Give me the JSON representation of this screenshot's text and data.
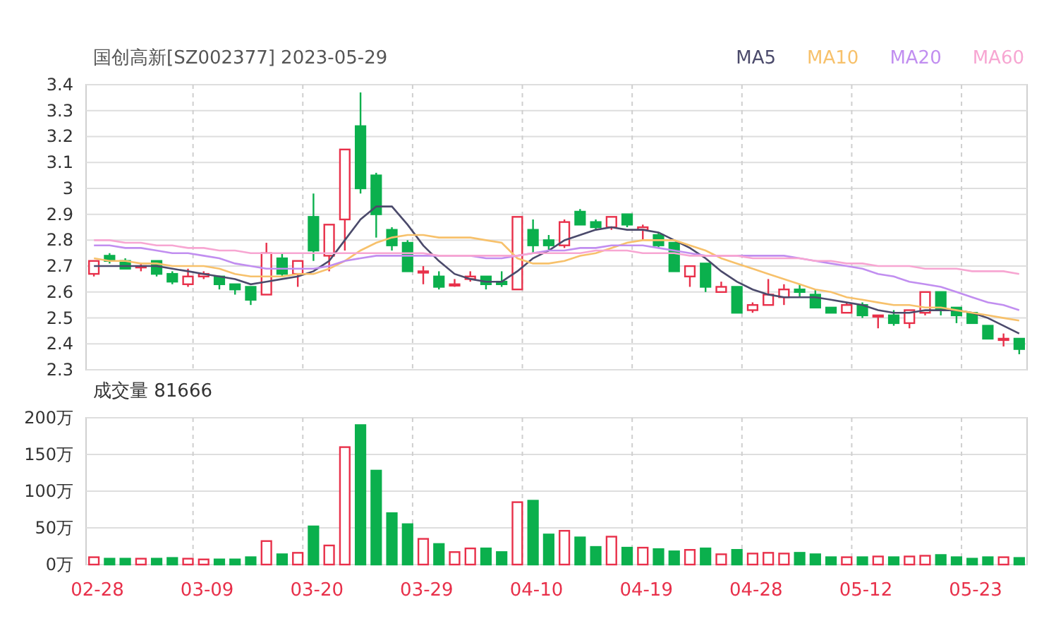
{
  "header": {
    "title": "国创高新[SZ002377] 2023-05-29"
  },
  "price_chart": {
    "chart_data": {
      "type": "candlestick",
      "grid": true,
      "categories": [
        null,
        null,
        null,
        null,
        null,
        null,
        null,
        null,
        null,
        null,
        null,
        null,
        null,
        null,
        null,
        null,
        null,
        null,
        null,
        null,
        null,
        null,
        null,
        null,
        null,
        null,
        null,
        null,
        null,
        null,
        null,
        null,
        null,
        null,
        null,
        null,
        null,
        null,
        null,
        null,
        null,
        null,
        null,
        null,
        null,
        null,
        null,
        null,
        null,
        null,
        null,
        null,
        null,
        null,
        null,
        null,
        null,
        null,
        null,
        null
      ],
      "ylim": [
        2.3,
        3.4
      ],
      "yticks": [
        {
          "value": 3.4,
          "label": "3.4"
        },
        {
          "value": 3.3,
          "label": "3.3"
        },
        {
          "value": 3.2,
          "label": "3.2"
        },
        {
          "value": 3.1,
          "label": "3.1"
        },
        {
          "value": 3.0,
          "label": "3"
        },
        {
          "value": 2.9,
          "label": "2.9"
        },
        {
          "value": 2.8,
          "label": "2.8"
        },
        {
          "value": 2.7,
          "label": "2.7"
        },
        {
          "value": 2.6,
          "label": "2.6"
        },
        {
          "value": 2.5,
          "label": "2.5"
        },
        {
          "value": 2.4,
          "label": "2.4"
        },
        {
          "value": 2.3,
          "label": "2.3"
        }
      ],
      "ohlc": [
        [
          2.67,
          2.72,
          2.66,
          2.72
        ],
        [
          2.74,
          2.75,
          2.71,
          2.72
        ],
        [
          2.72,
          2.73,
          2.69,
          2.69
        ],
        [
          2.7,
          2.71,
          2.68,
          2.7
        ],
        [
          2.72,
          2.72,
          2.66,
          2.67
        ],
        [
          2.67,
          2.68,
          2.63,
          2.64
        ],
        [
          2.63,
          2.69,
          2.62,
          2.66
        ],
        [
          2.66,
          2.68,
          2.65,
          2.67
        ],
        [
          2.66,
          2.66,
          2.61,
          2.63
        ],
        [
          2.63,
          2.63,
          2.59,
          2.61
        ],
        [
          2.62,
          2.62,
          2.55,
          2.57
        ],
        [
          2.59,
          2.79,
          2.59,
          2.75
        ],
        [
          2.73,
          2.75,
          2.66,
          2.67
        ],
        [
          2.67,
          2.72,
          2.62,
          2.72
        ],
        [
          2.89,
          2.98,
          2.72,
          2.76
        ],
        [
          2.74,
          2.86,
          2.68,
          2.86
        ],
        [
          2.88,
          3.15,
          2.76,
          3.15
        ],
        [
          3.24,
          3.37,
          2.98,
          3.0
        ],
        [
          3.05,
          3.06,
          2.81,
          2.9
        ],
        [
          2.84,
          2.85,
          2.76,
          2.78
        ],
        [
          2.79,
          2.8,
          2.68,
          2.68
        ],
        [
          2.68,
          2.7,
          2.63,
          2.68
        ],
        [
          2.66,
          2.68,
          2.61,
          2.62
        ],
        [
          2.63,
          2.65,
          2.62,
          2.63
        ],
        [
          2.65,
          2.68,
          2.64,
          2.66
        ],
        [
          2.66,
          2.66,
          2.61,
          2.63
        ],
        [
          2.64,
          2.68,
          2.62,
          2.63
        ],
        [
          2.61,
          2.89,
          2.61,
          2.89
        ],
        [
          2.84,
          2.88,
          2.75,
          2.78
        ],
        [
          2.8,
          2.82,
          2.76,
          2.78
        ],
        [
          2.78,
          2.88,
          2.77,
          2.87
        ],
        [
          2.91,
          2.92,
          2.86,
          2.86
        ],
        [
          2.87,
          2.88,
          2.84,
          2.85
        ],
        [
          2.85,
          2.89,
          2.84,
          2.89
        ],
        [
          2.9,
          2.9,
          2.85,
          2.86
        ],
        [
          2.84,
          2.86,
          2.8,
          2.85
        ],
        [
          2.82,
          2.83,
          2.77,
          2.78
        ],
        [
          2.79,
          2.79,
          2.68,
          2.68
        ],
        [
          2.66,
          2.7,
          2.62,
          2.7
        ],
        [
          2.71,
          2.71,
          2.6,
          2.62
        ],
        [
          2.6,
          2.64,
          2.6,
          2.62
        ],
        [
          2.62,
          2.62,
          2.52,
          2.52
        ],
        [
          2.53,
          2.56,
          2.52,
          2.55
        ],
        [
          2.55,
          2.65,
          2.55,
          2.59
        ],
        [
          2.58,
          2.63,
          2.55,
          2.61
        ],
        [
          2.61,
          2.63,
          2.58,
          2.6
        ],
        [
          2.59,
          2.61,
          2.54,
          2.54
        ],
        [
          2.54,
          2.54,
          2.52,
          2.52
        ],
        [
          2.52,
          2.56,
          2.52,
          2.55
        ],
        [
          2.55,
          2.56,
          2.5,
          2.51
        ],
        [
          2.51,
          2.51,
          2.46,
          2.51
        ],
        [
          2.51,
          2.53,
          2.47,
          2.48
        ],
        [
          2.48,
          2.53,
          2.46,
          2.53
        ],
        [
          2.52,
          2.6,
          2.51,
          2.6
        ],
        [
          2.6,
          2.6,
          2.51,
          2.53
        ],
        [
          2.54,
          2.54,
          2.48,
          2.51
        ],
        [
          2.52,
          2.52,
          2.48,
          2.48
        ],
        [
          2.47,
          2.47,
          2.42,
          2.42
        ],
        [
          2.42,
          2.44,
          2.39,
          2.42
        ],
        [
          2.42,
          2.42,
          2.36,
          2.38
        ]
      ]
    }
  },
  "ma_chart": {
    "chart_data": {
      "type": "line",
      "categories": [
        null,
        null,
        null,
        null,
        null,
        null,
        null,
        null,
        null,
        null,
        null,
        null,
        null,
        null,
        null,
        null,
        null,
        null,
        null,
        null,
        null,
        null,
        null,
        null,
        null,
        null,
        null,
        null,
        null,
        null,
        null,
        null,
        null,
        null,
        null,
        null,
        null,
        null,
        null,
        null,
        null,
        null,
        null,
        null,
        null,
        null,
        null,
        null,
        null,
        null,
        null,
        null,
        null,
        null,
        null,
        null,
        null,
        null,
        null,
        null
      ],
      "ylim": [
        2.3,
        3.4
      ],
      "series": [
        {
          "name": "MA5",
          "color": "#4b4a6b",
          "values": [
            2.7,
            2.7,
            2.7,
            2.7,
            2.7,
            2.69,
            2.68,
            2.67,
            2.66,
            2.65,
            2.63,
            2.64,
            2.65,
            2.66,
            2.68,
            2.72,
            2.8,
            2.88,
            2.93,
            2.93,
            2.86,
            2.78,
            2.72,
            2.67,
            2.65,
            2.64,
            2.64,
            2.68,
            2.73,
            2.76,
            2.8,
            2.82,
            2.84,
            2.85,
            2.84,
            2.84,
            2.83,
            2.8,
            2.77,
            2.73,
            2.68,
            2.64,
            2.61,
            2.59,
            2.58,
            2.58,
            2.58,
            2.57,
            2.56,
            2.55,
            2.53,
            2.52,
            2.52,
            2.53,
            2.53,
            2.53,
            2.52,
            2.5,
            2.47,
            2.44
          ]
        },
        {
          "name": "MA10",
          "color": "#f7c16b",
          "values": [
            2.73,
            2.72,
            2.72,
            2.71,
            2.71,
            2.7,
            2.7,
            2.7,
            2.69,
            2.67,
            2.66,
            2.66,
            2.66,
            2.67,
            2.67,
            2.69,
            2.72,
            2.76,
            2.79,
            2.81,
            2.82,
            2.82,
            2.81,
            2.81,
            2.81,
            2.8,
            2.79,
            2.73,
            2.71,
            2.71,
            2.72,
            2.74,
            2.75,
            2.77,
            2.79,
            2.8,
            2.8,
            2.8,
            2.78,
            2.76,
            2.73,
            2.71,
            2.69,
            2.67,
            2.65,
            2.63,
            2.61,
            2.6,
            2.58,
            2.57,
            2.56,
            2.55,
            2.55,
            2.54,
            2.54,
            2.53,
            2.52,
            2.51,
            2.5,
            2.49
          ]
        },
        {
          "name": "MA20",
          "color": "#c18ef0",
          "values": [
            2.78,
            2.78,
            2.77,
            2.77,
            2.76,
            2.75,
            2.75,
            2.74,
            2.73,
            2.71,
            2.7,
            2.69,
            2.69,
            2.69,
            2.69,
            2.7,
            2.72,
            2.73,
            2.74,
            2.74,
            2.74,
            2.74,
            2.74,
            2.74,
            2.74,
            2.73,
            2.73,
            2.74,
            2.75,
            2.76,
            2.76,
            2.77,
            2.77,
            2.78,
            2.78,
            2.78,
            2.77,
            2.76,
            2.75,
            2.74,
            2.74,
            2.74,
            2.74,
            2.74,
            2.74,
            2.73,
            2.72,
            2.71,
            2.7,
            2.69,
            2.67,
            2.66,
            2.64,
            2.63,
            2.62,
            2.6,
            2.58,
            2.56,
            2.55,
            2.53
          ]
        },
        {
          "name": "MA60",
          "color": "#f7a6d2",
          "values": [
            2.8,
            2.8,
            2.79,
            2.79,
            2.78,
            2.78,
            2.77,
            2.77,
            2.76,
            2.76,
            2.75,
            2.75,
            2.75,
            2.75,
            2.75,
            2.75,
            2.75,
            2.75,
            2.75,
            2.75,
            2.75,
            2.75,
            2.74,
            2.74,
            2.74,
            2.74,
            2.74,
            2.74,
            2.75,
            2.75,
            2.75,
            2.75,
            2.76,
            2.76,
            2.76,
            2.75,
            2.75,
            2.75,
            2.74,
            2.74,
            2.74,
            2.74,
            2.73,
            2.73,
            2.73,
            2.73,
            2.72,
            2.72,
            2.71,
            2.71,
            2.7,
            2.7,
            2.7,
            2.69,
            2.69,
            2.69,
            2.68,
            2.68,
            2.68,
            2.67
          ]
        }
      ]
    }
  },
  "volume_chart": {
    "title": "成交量 81666",
    "chart_data": {
      "type": "bar",
      "grid": true,
      "ylim": [
        0,
        200
      ],
      "categories": [
        "02-28",
        null,
        null,
        null,
        null,
        null,
        null,
        "03-09",
        null,
        null,
        null,
        null,
        null,
        null,
        "03-20",
        null,
        null,
        null,
        null,
        null,
        null,
        "03-29",
        null,
        null,
        null,
        null,
        null,
        null,
        "04-10",
        null,
        null,
        null,
        null,
        null,
        null,
        "04-19",
        null,
        null,
        null,
        null,
        null,
        null,
        "04-28",
        null,
        null,
        null,
        null,
        null,
        null,
        "05-12",
        null,
        null,
        null,
        null,
        null,
        null,
        "05-23",
        null,
        null,
        null
      ],
      "yticks": [
        {
          "value": 200,
          "label": "200万"
        },
        {
          "value": 150,
          "label": "150万"
        },
        {
          "value": 100,
          "label": "100万"
        },
        {
          "value": 50,
          "label": "50万"
        },
        {
          "value": 0,
          "label": "0万"
        }
      ],
      "values": [
        10,
        8,
        8,
        8,
        8,
        9,
        8,
        7,
        7,
        7,
        10,
        32,
        14,
        16,
        52,
        26,
        160,
        190,
        128,
        70,
        55,
        35,
        28,
        17,
        22,
        22,
        17,
        85,
        87,
        41,
        46,
        37,
        24,
        38,
        23,
        23,
        21,
        18,
        20,
        22,
        14,
        20,
        15,
        16,
        15,
        16,
        14,
        10,
        10,
        10,
        11,
        10,
        11,
        12,
        13,
        10,
        8,
        10,
        10,
        9
      ]
    }
  }
}
